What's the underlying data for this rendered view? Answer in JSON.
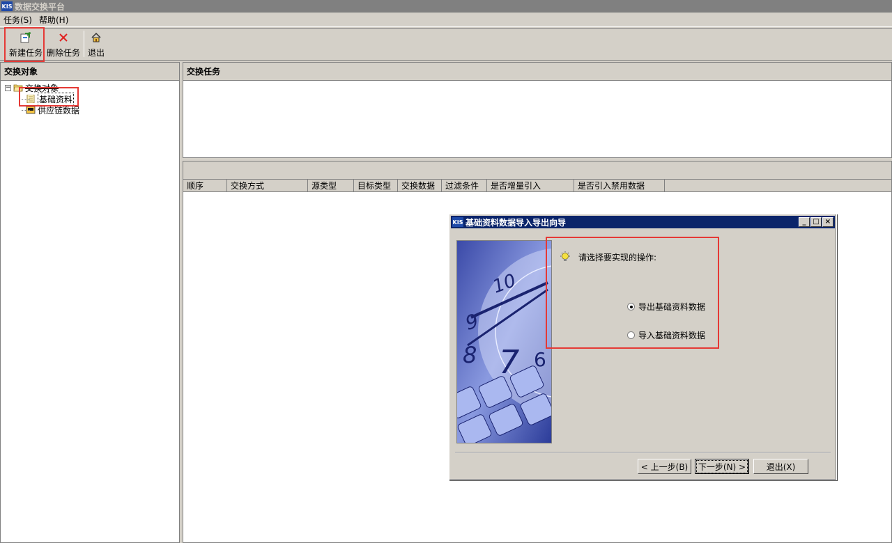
{
  "window": {
    "app_icon_text": "KIS",
    "title": "数据交换平台"
  },
  "menubar": {
    "items": [
      "任务(S)",
      "帮助(H)"
    ]
  },
  "toolbar": {
    "new_task_label": "新建任务",
    "delete_task_label": "删除任务",
    "exit_label": "退出"
  },
  "left_pane": {
    "header": "交换对象",
    "tree": {
      "root_label": "交换对象",
      "children": [
        "基础资料",
        "供应链数据"
      ]
    }
  },
  "right_pane": {
    "header": "交换任务",
    "columns": [
      "顺序",
      "交换方式",
      "源类型",
      "目标类型",
      "交换数据",
      "过滤条件",
      "是否增量引入",
      "是否引入禁用数据"
    ]
  },
  "dialog": {
    "app_icon_text": "KIS",
    "title": "基础资料数据导入导出向导",
    "prompt": "请选择要实现的操作:",
    "options": [
      {
        "label": "导出基础资料数据",
        "selected": true
      },
      {
        "label": "导入基础资料数据",
        "selected": false
      }
    ],
    "buttons": {
      "prev": "< 上一步(B)",
      "next": "下一步(N) >",
      "exit": "退出(X)"
    }
  },
  "colors": {
    "title_bar_inactive": "#808080",
    "dialog_title_active": "#0a246a",
    "annotation_red": "#e53935",
    "window_face": "#d4d0c8"
  }
}
